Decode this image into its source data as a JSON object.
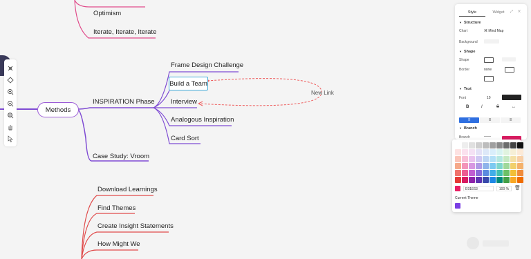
{
  "mindmap": {
    "nodes": {
      "optimism": "Optimism",
      "iterate": "Iterate, Iterate, Iterate",
      "methods": "Methods",
      "inspiration": "INSPIRATION Phase",
      "frame_design": "Frame Design Challenge",
      "build_team": "Build a Team",
      "interview": "Interview",
      "analogous": "Analogous Inspiration",
      "card_sort": "Card Sort",
      "case_study": "Case Study: Vroom",
      "download_learnings": "Download Learnings",
      "find_themes": "Find Themes",
      "insight_statements": "Create Insight Statements",
      "how_might_we": "How Might We"
    },
    "link_label": "New Link"
  },
  "left_toolbar": {
    "icons": [
      "select-icon",
      "brush-icon",
      "zoom-in-icon",
      "zoom-out-icon",
      "fit-icon",
      "hand-icon",
      "pointer-icon"
    ]
  },
  "panel": {
    "tabs": [
      "Style",
      "Widget"
    ],
    "structure": {
      "title": "Structure",
      "chart_label": "Chart",
      "chart_value": "Mind Map",
      "background_label": "Background"
    },
    "shape": {
      "title": "Shape",
      "shape_label": "Shape",
      "border_label": "Border",
      "border_value": "none"
    },
    "text": {
      "title": "Text",
      "font_label": "Font",
      "font_size": "10",
      "bold": "B",
      "italic": "I",
      "strike": "S"
    },
    "branch": {
      "title": "Branch",
      "branch_label": "Branch",
      "branch_color": "#d81b60"
    }
  },
  "color_picker": {
    "hex_value": "E91E63",
    "opacity": "100 %",
    "current_theme_label": "Current Theme",
    "theme_color": "#7b3fe4",
    "swatches": [
      "#ffffff",
      "#eeeeee",
      "#e0e0e0",
      "#cfcfcf",
      "#bdbdbd",
      "#a0a0a0",
      "#8a8a8a",
      "#6b6b6b",
      "#444444",
      "#111111",
      "#fde2e2",
      "#fbe1ee",
      "#f4e1f4",
      "#e3e1f6",
      "#dde8f8",
      "#d9eefb",
      "#d8f3f1",
      "#e0f3df",
      "#f6efd6",
      "#fce9d6",
      "#fbc4b8",
      "#f8bfd6",
      "#e9c3ee",
      "#cfc8f2",
      "#bdd5f3",
      "#b3e0f7",
      "#b4e7e1",
      "#c5e9c2",
      "#f4e0a6",
      "#f8cfa6",
      "#f6a98a",
      "#f395b9",
      "#d798e2",
      "#b09be6",
      "#8fb3ea",
      "#7ccaf1",
      "#7ed6cc",
      "#9fd89a",
      "#f1d06b",
      "#f4b16b",
      "#f0726b",
      "#ec5c92",
      "#c15fd1",
      "#8a6cd9",
      "#5b8bdf",
      "#41aee8",
      "#3fbfb0",
      "#6cc067",
      "#f2bf36",
      "#f08b3a",
      "#e53935",
      "#d81b60",
      "#8e24aa",
      "#5e35b1",
      "#3949ab",
      "#1e88e5",
      "#00897b",
      "#43a047",
      "#f9a825",
      "#ef6c00"
    ]
  }
}
